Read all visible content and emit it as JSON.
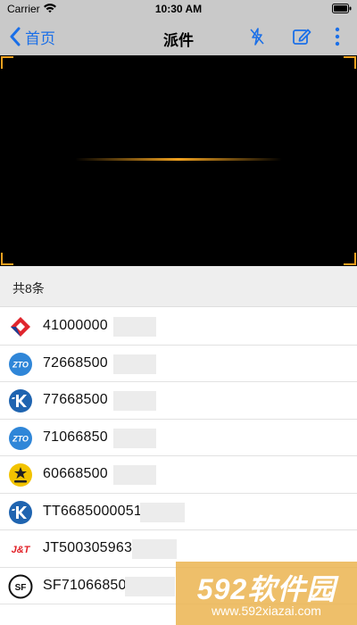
{
  "status_bar": {
    "carrier": "Carrier",
    "time": "10:30 AM"
  },
  "nav": {
    "back_label": "首页",
    "title": "派件"
  },
  "count_header": {
    "text": "共8条"
  },
  "parcels": [
    {
      "tracking": "41000000",
      "carrier_icon": "jingdong-logo-icon",
      "color": "#e0262e"
    },
    {
      "tracking": "72668500",
      "carrier_icon": "zto-logo-icon",
      "color": "#2f86d8"
    },
    {
      "tracking": "77668500",
      "carrier_icon": "kuayue-logo-icon",
      "color": "#1f64b0"
    },
    {
      "tracking": "71066850",
      "carrier_icon": "zto-logo-icon",
      "color": "#2f86d8"
    },
    {
      "tracking": "60668500",
      "carrier_icon": "yunda-logo-icon",
      "color": "#f2c300"
    },
    {
      "tracking": "TT6685000051",
      "carrier_icon": "kuayue-logo-icon",
      "color": "#1f64b0"
    },
    {
      "tracking": "JT500305963",
      "carrier_icon": "jt-express-logo-icon",
      "color": "#e21f26"
    },
    {
      "tracking": "SF710668500",
      "carrier_icon": "sf-express-logo-icon",
      "color": "#111111"
    }
  ],
  "watermark": {
    "main": "592软件园",
    "url": "www.592xiazai.com"
  },
  "colors": {
    "accent": "#1a6fe8",
    "scan": "#f0a11f",
    "bar": "#c9c9c9"
  }
}
